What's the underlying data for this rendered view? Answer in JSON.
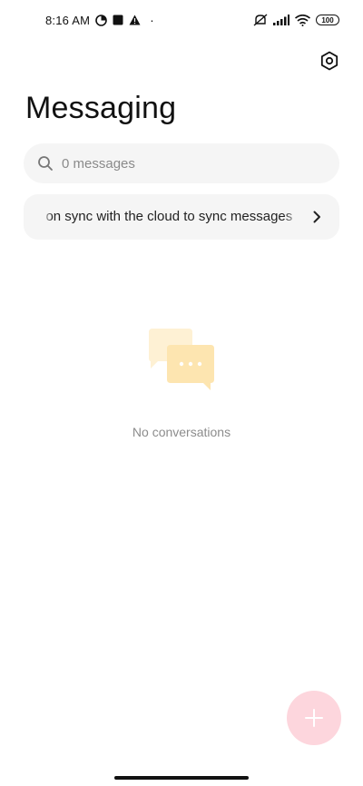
{
  "status_bar": {
    "time": "8:16 AM",
    "battery": "100",
    "dot": "·"
  },
  "header": {
    "title": "Messaging"
  },
  "search": {
    "placeholder": "0 messages"
  },
  "sync_banner": {
    "text": "Turn on sync with the cloud to sync messages"
  },
  "empty_state": {
    "text": "No conversations"
  },
  "colors": {
    "fab": "#fdd6dd",
    "illustration": "#fde5b0"
  }
}
